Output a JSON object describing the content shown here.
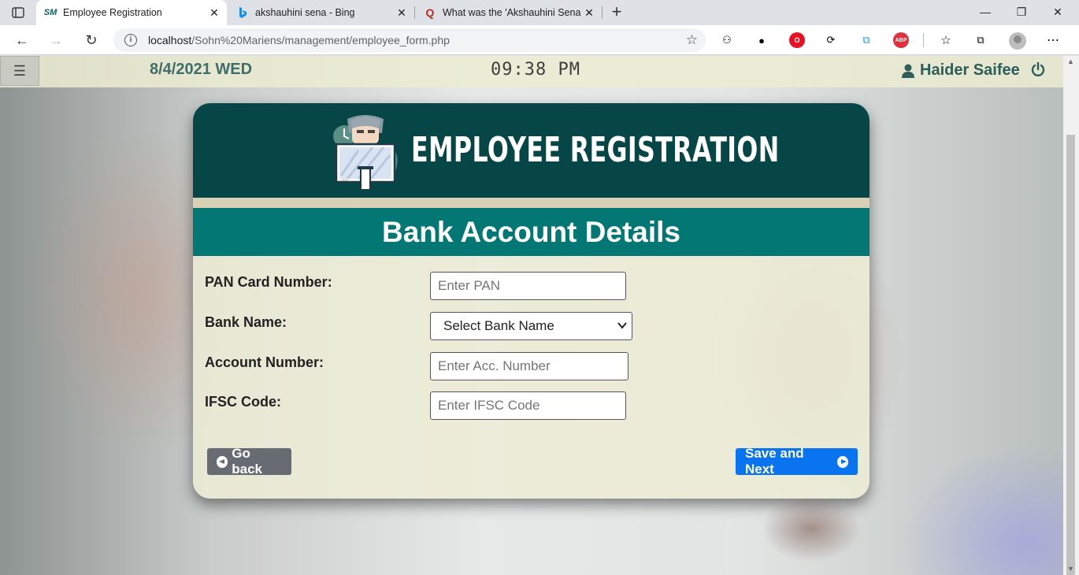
{
  "browser": {
    "tabs": [
      {
        "favicon": "SM",
        "title": "Employee Registration",
        "active": true
      },
      {
        "favicon": "bing-icon",
        "title": "akshauhini sena - Bing",
        "active": false
      },
      {
        "favicon": "Q",
        "title": "What was the 'Akshauhini Sena' (",
        "active": false
      }
    ],
    "url_host": "localhost",
    "url_path": "/Sohn%20Mariens/management/employee_form.php"
  },
  "header": {
    "date": "8/4/2021 WED",
    "time": "09:38 PM",
    "user_name": "Haider Saifee"
  },
  "card": {
    "title": "EMPLOYEE REGISTRATION",
    "section_title": "Bank Account Details"
  },
  "form": {
    "pan_label": "PAN Card Number:",
    "pan_placeholder": "Enter PAN",
    "bank_label": "Bank Name:",
    "bank_selected": "Select Bank Name",
    "account_label": "Account Number:",
    "account_placeholder": "Enter Acc. Number",
    "ifsc_label": "IFSC Code:",
    "ifsc_placeholder": "Enter IFSC Code"
  },
  "buttons": {
    "back": "Go back",
    "next": "Save and Next"
  },
  "colors": {
    "header_bg": "#064646",
    "section_bg": "#027774",
    "next_button": "#0a74f0",
    "back_button": "#666c72"
  }
}
